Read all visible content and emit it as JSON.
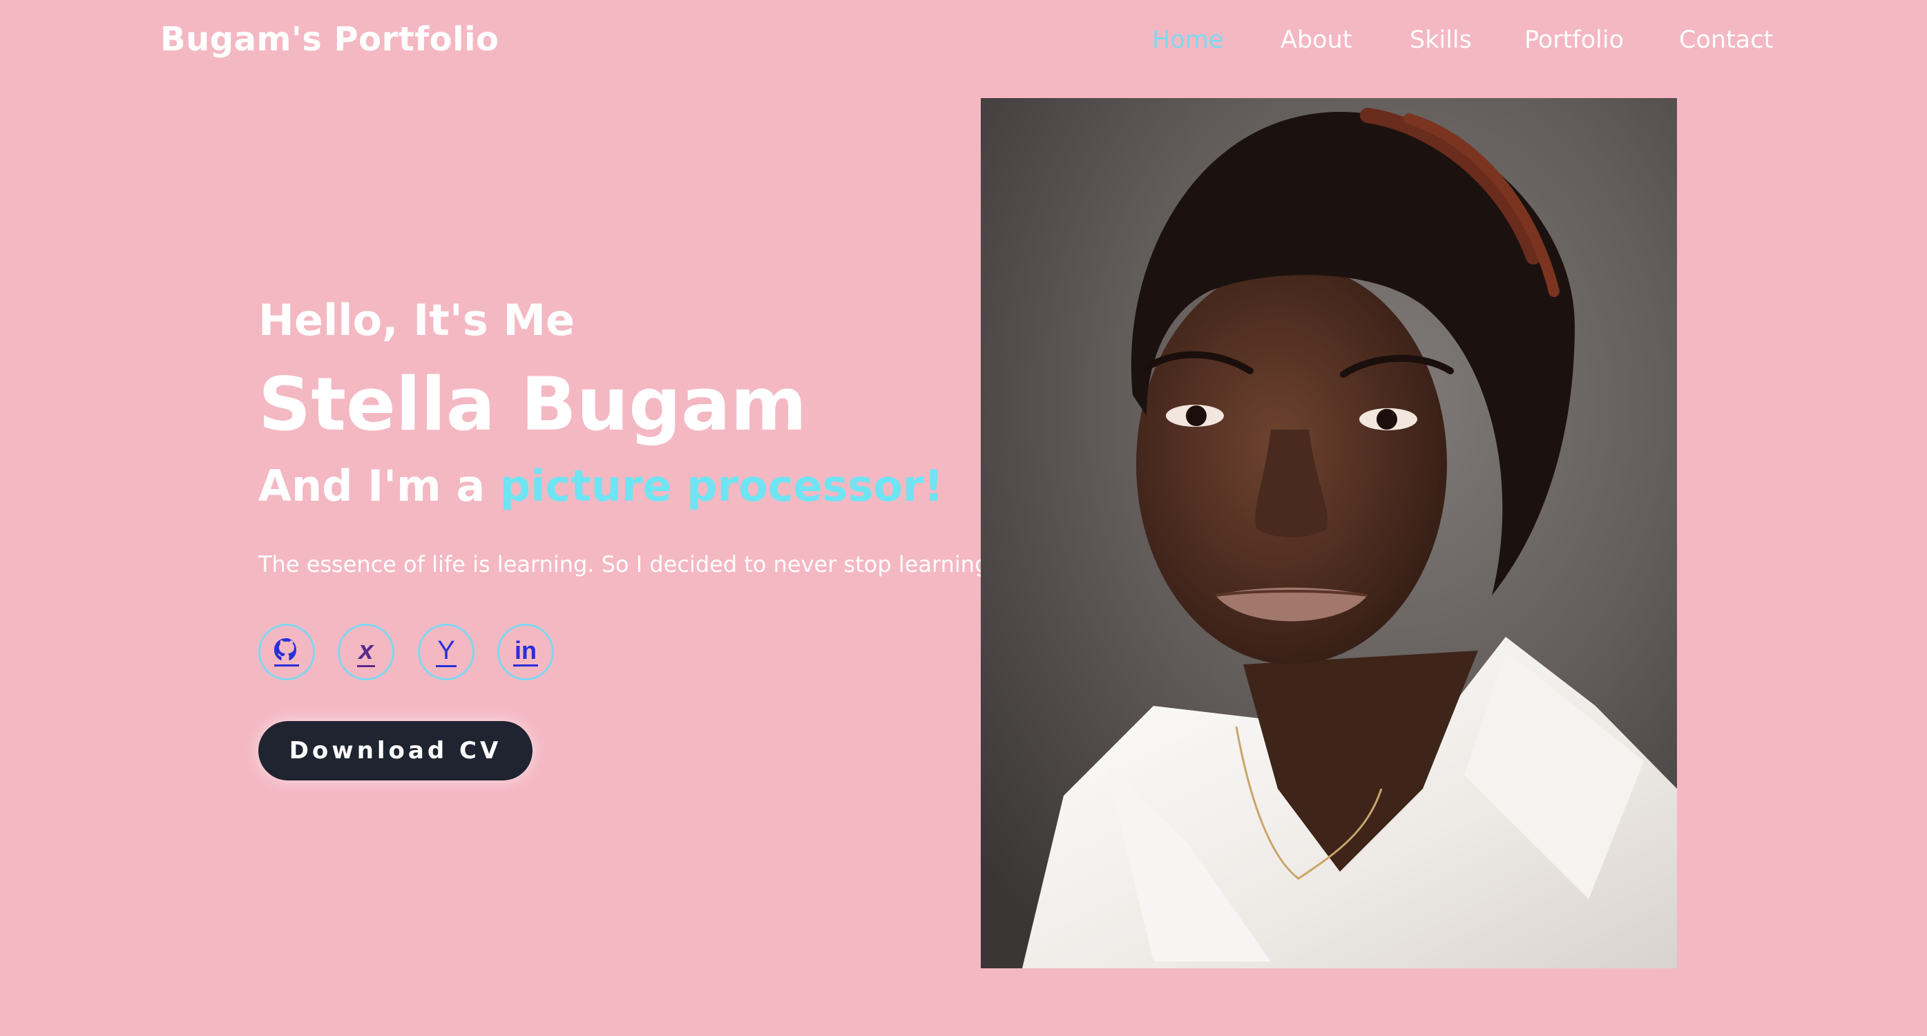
{
  "header": {
    "logo": "Bugam's Portfolio",
    "nav": [
      {
        "label": "Home",
        "active": true
      },
      {
        "label": "About",
        "active": false
      },
      {
        "label": "Skills",
        "active": false
      },
      {
        "label": "Portfolio",
        "active": false
      },
      {
        "label": "Contact",
        "active": false
      }
    ]
  },
  "hero": {
    "greeting": "Hello, It's Me",
    "name": "Stella Bugam",
    "role_prefix": "And I'm a ",
    "role_highlight": "picture processor!",
    "tagline": "The essence of life is learning. So I decided to never stop learning!",
    "cv_button": "Download CV"
  },
  "socials": [
    {
      "icon": "github-icon"
    },
    {
      "icon": "xing-icon"
    },
    {
      "icon": "ycombinator-icon"
    },
    {
      "icon": "linkedin-icon"
    }
  ],
  "socials_glyphs": {
    "xing": "x",
    "ycomb": "Y",
    "linkedin": "in"
  },
  "colors": {
    "background": "#f4b8c3",
    "text": "#ffffff",
    "accent": "#6fe4f3",
    "nav_active": "#7ed8f0",
    "icon_border": "#7ed8f0",
    "icon_glyph": "#2a2fd6",
    "button_bg": "#1f2430"
  }
}
